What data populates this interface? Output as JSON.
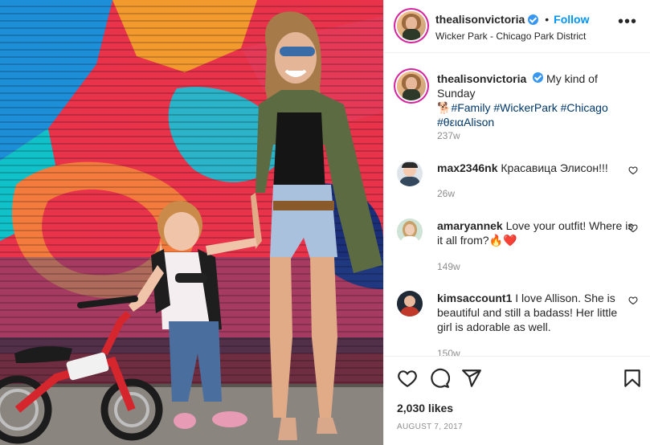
{
  "post": {
    "username": "thealisonvictoria",
    "follow_label": "Follow",
    "location": "Wicker Park - Chicago Park District",
    "more_label": "•••",
    "photo_alt": "Woman and little girl with red bike in front of graffiti shutter"
  },
  "caption": {
    "username": "thealisonvictoria",
    "text": "My kind of Sunday",
    "hashtags": [
      "#Family",
      "#WickerPark",
      "#Chicago",
      "#θειαAlison"
    ],
    "emoji": "🐕",
    "time": "237w"
  },
  "comments": [
    {
      "username": "max2346nk",
      "text": "Красавица Элисон!!!",
      "time": "26w"
    },
    {
      "username": "amaryannek",
      "text": "Love your outfit! Where is it all from?🔥❤️",
      "time": "149w"
    },
    {
      "username": "kimsaccount1",
      "text": "I love Allison. She is beautiful and still a badass! Her little girl is adorable as well.",
      "time": "150w"
    }
  ],
  "actions": {
    "like_icon": "heart-icon",
    "comment_icon": "comment-icon",
    "share_icon": "share-icon",
    "save_icon": "bookmark-icon",
    "likes": "2,030 likes",
    "date": "AUGUST 7, 2017"
  },
  "colors": {
    "link": "#0095f6",
    "hashtag": "#00376b",
    "muted": "#8e8e8e",
    "verified": "#3897f0"
  }
}
